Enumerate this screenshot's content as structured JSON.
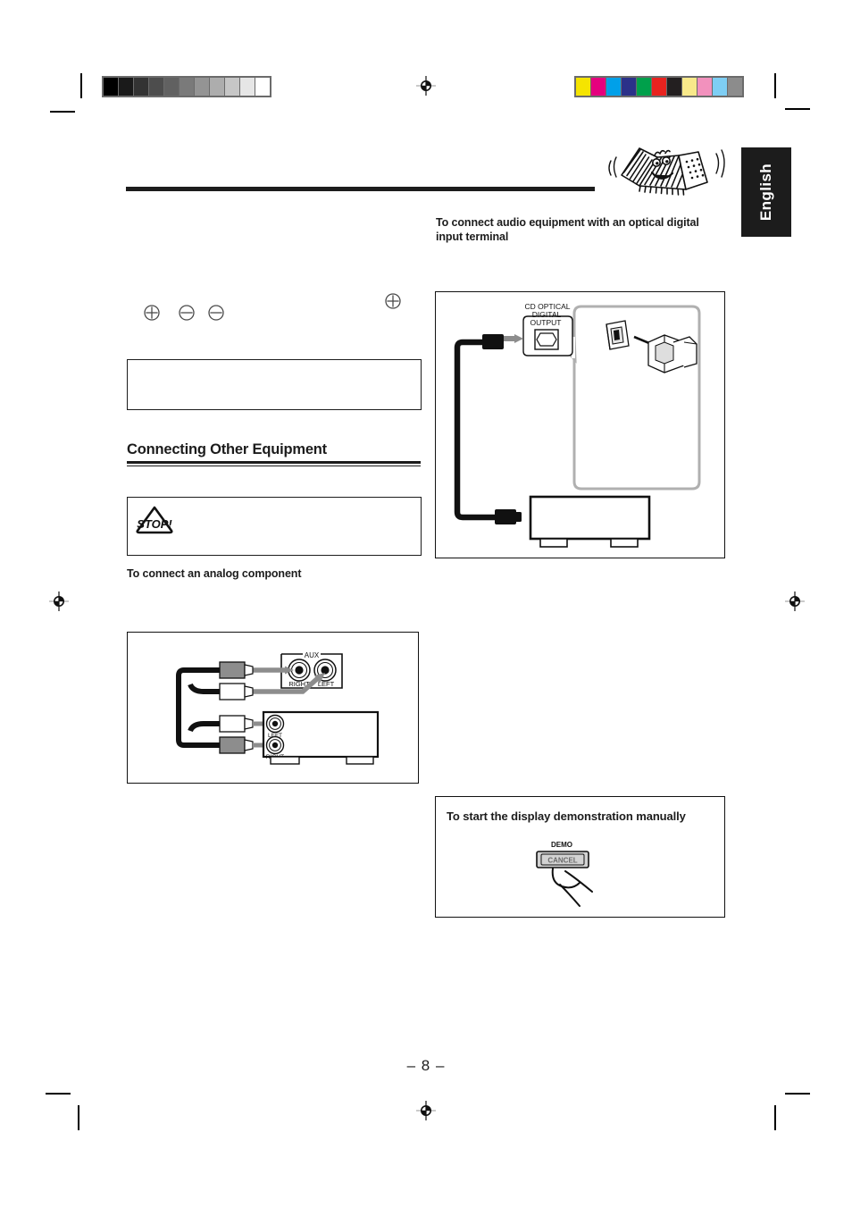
{
  "page": {
    "number_label": "– 8 –",
    "language_tab": "English"
  },
  "calibration": {
    "grayscale_label": "grayscale-calibration-bar",
    "grayscale_swatches": [
      "#000000",
      "#1a1a1a",
      "#333333",
      "#4d4d4d",
      "#616161",
      "#7a7a7a",
      "#949494",
      "#adadad",
      "#c6c6c6",
      "#e6e6e6",
      "#ffffff"
    ],
    "color_label": "color-calibration-bar",
    "color_swatches": [
      "#f5e400",
      "#e5007e",
      "#00a0e9",
      "#2b3189",
      "#00a04b",
      "#e8231f",
      "#231f20",
      "#f8e98a",
      "#f291bd",
      "#7ecef4",
      "#8c8c8c"
    ]
  },
  "sections": {
    "optical": {
      "heading": "To connect audio equipment with an optical digital input terminal",
      "figure": {
        "terminal_label_line1": "CD OPTICAL",
        "terminal_label_line2": "DIGITAL",
        "terminal_label_line3": "OUTPUT"
      }
    },
    "connecting_other_equipment": {
      "heading": "Connecting Other Equipment",
      "caution_icon_label": "STOP!",
      "analog_subhead": "To connect an analog component",
      "figure": {
        "aux_label": "AUX",
        "aux_right": "RIGHT",
        "aux_left": "LEFT",
        "component_left": "LEFT",
        "component_right": "RIGHT"
      }
    },
    "demo": {
      "heading": "To start the display demonstration manually",
      "button_top_label": "DEMO",
      "button_label": "CANCEL"
    }
  },
  "symbols": {
    "plus": "⊕",
    "minus": "⊖"
  }
}
